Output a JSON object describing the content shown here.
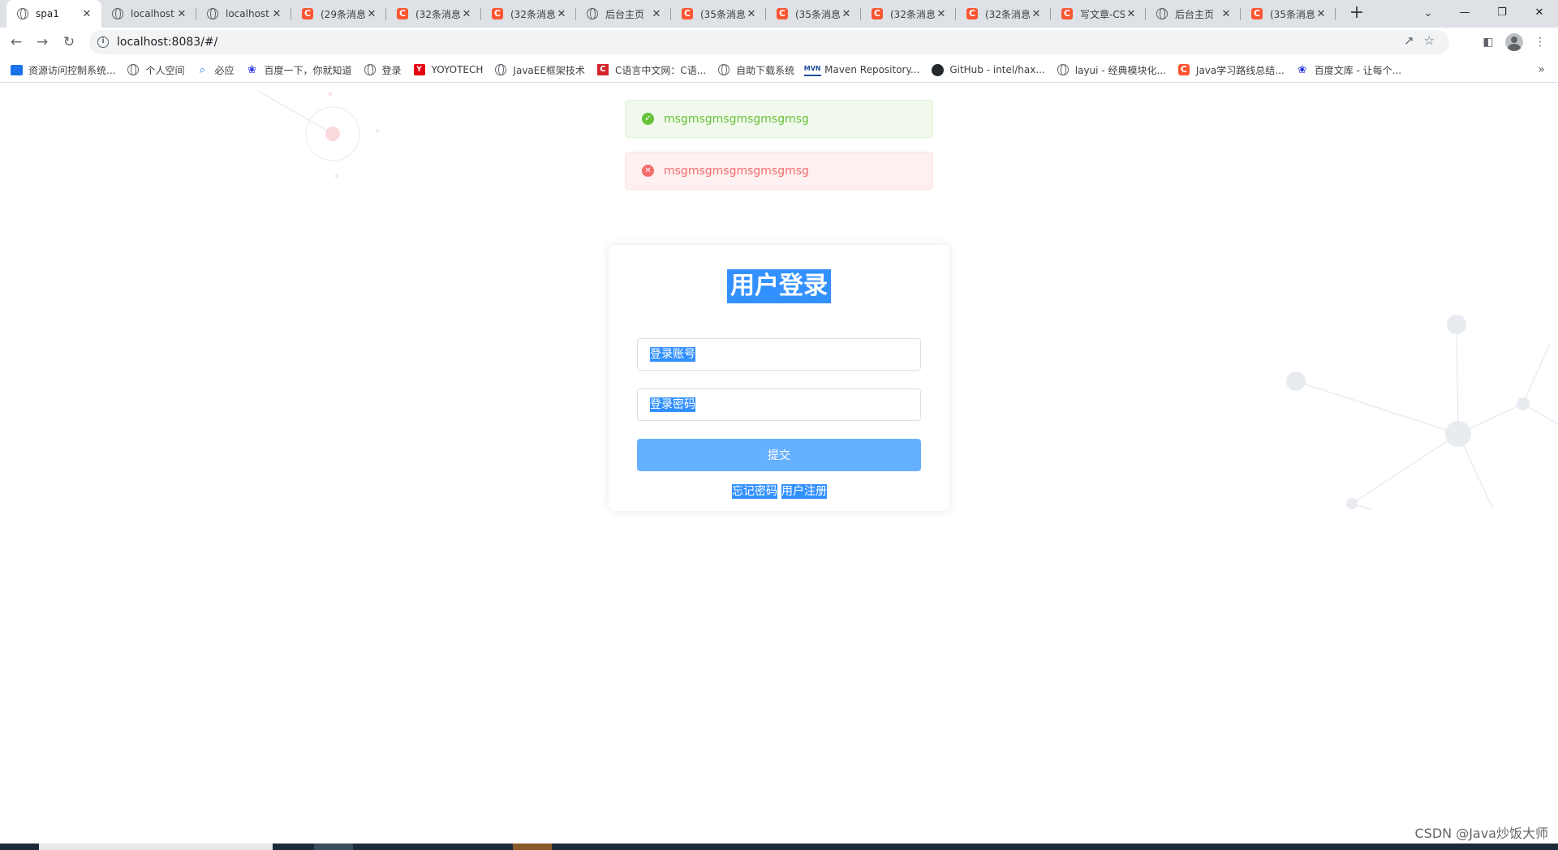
{
  "browser": {
    "tabs": [
      {
        "title": "spa1",
        "icon": "globe-icon",
        "active": true
      },
      {
        "title": "localhost",
        "icon": "globe-icon"
      },
      {
        "title": "localhost",
        "icon": "globe-icon"
      },
      {
        "title": "(29条消息",
        "icon": "csdn-icon"
      },
      {
        "title": "(32条消息",
        "icon": "csdn-icon"
      },
      {
        "title": "(32条消息",
        "icon": "csdn-icon"
      },
      {
        "title": "后台主页",
        "icon": "globe-icon"
      },
      {
        "title": "(35条消息",
        "icon": "csdn-icon"
      },
      {
        "title": "(35条消息",
        "icon": "csdn-icon"
      },
      {
        "title": "(32条消息",
        "icon": "csdn-icon"
      },
      {
        "title": "(32条消息",
        "icon": "csdn-icon"
      },
      {
        "title": "写文章-CS",
        "icon": "csdn-icon"
      },
      {
        "title": "后台主页",
        "icon": "globe-icon"
      },
      {
        "title": "(35条消息",
        "icon": "csdn-icon"
      }
    ],
    "url": "localhost:8083/#/",
    "bookmarks": [
      {
        "label": "资源访问控制系统...",
        "icon": "folder-icon"
      },
      {
        "label": "个人空间",
        "icon": "globe-icon"
      },
      {
        "label": "必应",
        "icon": "bing-icon"
      },
      {
        "label": "百度一下，你就知道",
        "icon": "baidu-icon"
      },
      {
        "label": "登录",
        "icon": "globe-icon"
      },
      {
        "label": "YOYOTECH",
        "icon": "yoyotech-icon"
      },
      {
        "label": "JavaEE框架技术",
        "icon": "globe-icon"
      },
      {
        "label": "C语言中文网：C语...",
        "icon": "c-icon"
      },
      {
        "label": "自助下载系统",
        "icon": "globe-icon"
      },
      {
        "label": "Maven Repository...",
        "icon": "maven-icon"
      },
      {
        "label": "GitHub - intel/hax...",
        "icon": "github-icon"
      },
      {
        "label": "layui - 经典模块化...",
        "icon": "globe-icon"
      },
      {
        "label": "Java学习路线总结...",
        "icon": "csdn-icon"
      },
      {
        "label": "百度文库 - 让每个...",
        "icon": "baidu-icon"
      }
    ]
  },
  "messages": {
    "success": "msgmsgmsgmsgmsgmsg",
    "error": "msgmsgmsgmsgmsgmsg"
  },
  "login": {
    "title": "用户登录",
    "username_placeholder": "登录账号",
    "password_placeholder": "登录密码",
    "submit_label": "提交",
    "forgot_label": "忘记密码",
    "register_label": "用户注册"
  },
  "watermark": "CSDN @Java炒饭大师",
  "colors": {
    "success": "#67c23a",
    "error": "#f56c6c",
    "primary_button": "#66b1ff",
    "selection": "#3390ff"
  }
}
